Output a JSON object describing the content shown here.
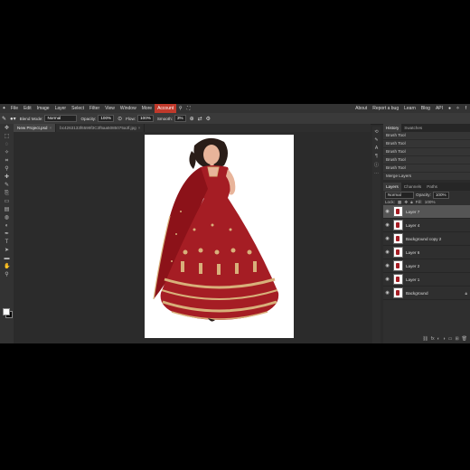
{
  "menu": {
    "items": [
      "File",
      "Edit",
      "Image",
      "Layer",
      "Select",
      "Filter",
      "View",
      "Window",
      "More"
    ],
    "account": "Account",
    "right": [
      "About",
      "Report a bug",
      "Learn",
      "Blog",
      "API"
    ]
  },
  "options": {
    "blend_mode_label": "Blend Mode:",
    "blend_mode": "Normal",
    "opacity_label": "Opacity:",
    "opacity": "100%",
    "flow_label": "Flow:",
    "flow": "100%",
    "smooth_label": "Smooth:",
    "smooth": "3%"
  },
  "tabs": [
    {
      "label": "New Project.psd"
    },
    {
      "label": "bc4263133f6599f3C3f5aa5085075a3f.jpg"
    }
  ],
  "history": {
    "tabs": [
      "History",
      "Swatches"
    ],
    "items": [
      "Brush Tool",
      "Brush Tool",
      "Brush Tool",
      "Brush Tool",
      "Brush Tool",
      "Merge Layers"
    ]
  },
  "layers": {
    "tabs": [
      "Layers",
      "Channels",
      "Paths"
    ],
    "blend": "Normal",
    "opacity_label": "Opacity:",
    "opacity": "100%",
    "lock_label": "Lock:",
    "fill_label": "Fill:",
    "fill": "100%",
    "items": [
      {
        "name": "Layer 7",
        "selected": true
      },
      {
        "name": "Layer 4",
        "selected": false
      },
      {
        "name": "Background copy 2",
        "selected": false
      },
      {
        "name": "Layer 6",
        "selected": false
      },
      {
        "name": "Layer 2",
        "selected": false
      },
      {
        "name": "Layer 1",
        "selected": false
      },
      {
        "name": "Background",
        "selected": false
      }
    ]
  },
  "colors": {
    "accent": "#c0392b",
    "dress": "#a51d24",
    "gold": "#d8b07a"
  }
}
